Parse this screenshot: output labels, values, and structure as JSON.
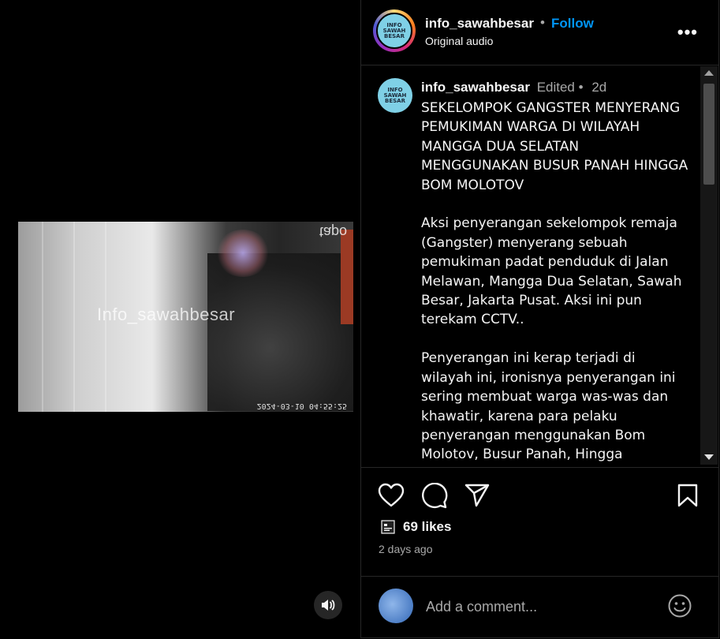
{
  "media": {
    "watermark": "Info_sawahbesar",
    "camera_brand": "tapo",
    "timestamp": "2024-03-10 04:55:25",
    "sound_icon": "speaker-icon"
  },
  "header": {
    "username": "info_sawahbesar",
    "separator": "•",
    "follow_label": "Follow",
    "audio": "Original audio",
    "more_icon": "•••",
    "avatar_text": "INFO SAWAH BESAR"
  },
  "caption": {
    "username": "info_sawahbesar",
    "edited": "Edited",
    "separator": "•",
    "time": "2d",
    "body": "SEKELOMPOK GANGSTER MENYERANG PEMUKIMAN WARGA DI WILAYAH MANGGA DUA SELATAN MENGGUNAKAN BUSUR PANAH HINGGA BOM MOLOTOV\n\nAksi penyerangan sekelompok remaja (Gangster) menyerang sebuah pemukiman padat penduduk di Jalan Melawan, Mangga Dua Selatan, Sawah Besar, Jakarta Pusat. Aksi ini pun terekam CCTV..\n\nPenyerangan ini kerap terjadi di wilayah ini, ironisnya penyerangan ini sering membuat warga was-was dan khawatir, karena para pelaku penyerangan menggunakan Bom Molotov, Busur Panah, Hingga"
  },
  "stats": {
    "likes": "69 likes",
    "posted": "2 days ago"
  },
  "comment": {
    "placeholder": "Add a comment..."
  },
  "colors": {
    "accent": "#0095f6",
    "background": "#000000",
    "muted": "#a8a8a8"
  }
}
